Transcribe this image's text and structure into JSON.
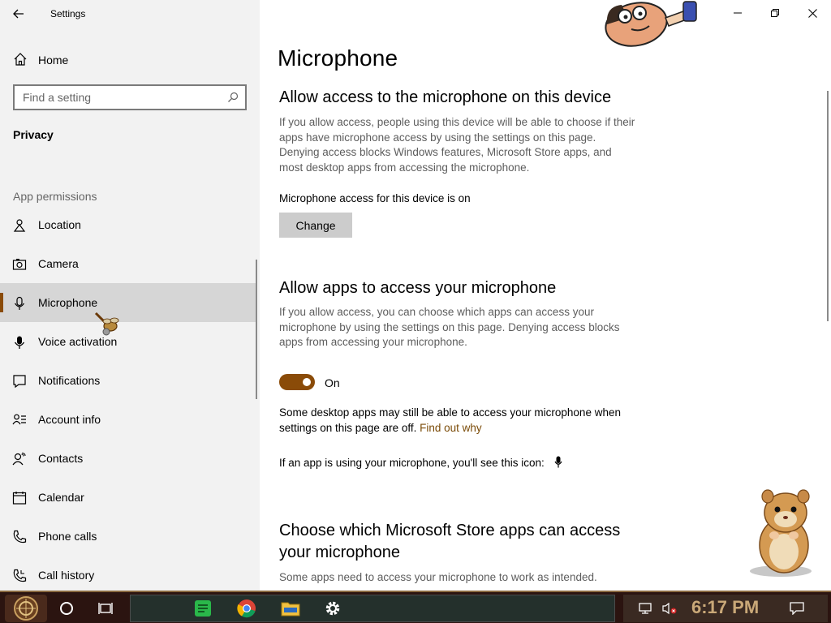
{
  "window": {
    "app_title": "Settings"
  },
  "sidebar": {
    "home_label": "Home",
    "search_placeholder": "Find a setting",
    "section_title": "Privacy",
    "group_label": "App permissions",
    "items": [
      {
        "label": "Location",
        "icon": "location-icon"
      },
      {
        "label": "Camera",
        "icon": "camera-icon"
      },
      {
        "label": "Microphone",
        "icon": "microphone-icon",
        "active": true
      },
      {
        "label": "Voice activation",
        "icon": "voice-activation-icon"
      },
      {
        "label": "Notifications",
        "icon": "notifications-icon"
      },
      {
        "label": "Account info",
        "icon": "account-info-icon"
      },
      {
        "label": "Contacts",
        "icon": "contacts-icon"
      },
      {
        "label": "Calendar",
        "icon": "calendar-icon"
      },
      {
        "label": "Phone calls",
        "icon": "phone-icon"
      },
      {
        "label": "Call history",
        "icon": "call-history-icon"
      }
    ]
  },
  "main": {
    "page_title": "Microphone",
    "device_section": {
      "heading": "Allow access to the microphone on this device",
      "description": "If you allow access, people using this device will be able to choose if their apps have microphone access by using the settings on this page. Denying access blocks Windows features, Microsoft Store apps, and most desktop apps from accessing the microphone.",
      "status": "Microphone access for this device is on",
      "change_label": "Change"
    },
    "apps_section": {
      "heading": "Allow apps to access your microphone",
      "description": "If you allow access, you can choose which apps can access your microphone by using the settings on this page. Denying access blocks apps from accessing your microphone.",
      "toggle_state": "On",
      "toggle_on": true,
      "desktop_note": "Some desktop apps may still be able to access your microphone when settings on this page are off.",
      "find_out_link": "Find out why",
      "icon_note": "If an app is using your microphone, you'll see this icon:"
    },
    "store_section": {
      "heading_line1": "Choose which Microsoft Store apps can access",
      "heading_line2": "your microphone",
      "description": "Some apps need to access your microphone to work as intended."
    }
  },
  "taskbar": {
    "time": "6:17 PM",
    "apps": [
      "cortana-icon",
      "task-view-icon",
      "notes-app-icon",
      "chrome-icon",
      "file-explorer-icon",
      "settings-icon"
    ],
    "tray": [
      "network-icon",
      "volume-muted-icon",
      "action-center-icon"
    ]
  },
  "colors": {
    "accent": "#8a4b08",
    "link": "#7a4a06",
    "sidebar_bg": "#f2f2f2",
    "active_item_bg": "#d6d6d6",
    "taskbar_bg": "#2b1410"
  }
}
